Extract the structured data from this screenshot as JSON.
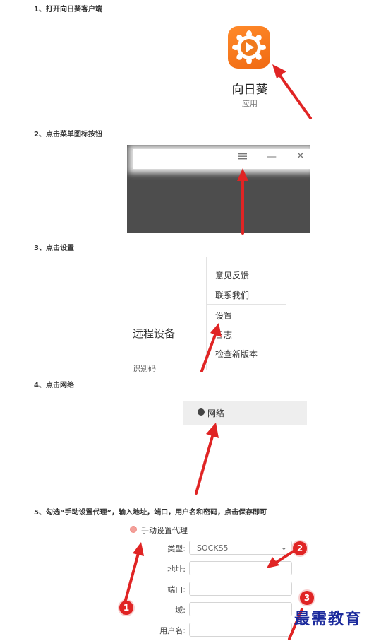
{
  "steps": {
    "step1": "1、打开向日葵客户端",
    "step2": "2、点击菜单图标按钮",
    "step3": "3、点击设置",
    "step4": "4、点击网络",
    "step5": "5、勾选“手动设置代理”，输入地址，端口，用户名和密码，点击保存即可"
  },
  "app": {
    "name": "向日葵",
    "subtitle": "应用"
  },
  "titlebar": {
    "menu_icon": "hamburger-icon",
    "minimize_glyph": "—",
    "close_glyph": "✕"
  },
  "menu": {
    "items": [
      "意见反馈",
      "联系我们",
      "设置",
      "日志",
      "检查新版本"
    ],
    "remote_label": "远程设备",
    "code_label": "识别码"
  },
  "network": {
    "label": "网络"
  },
  "proxy_form": {
    "radio_label": "手动设置代理",
    "type_label": "类型:",
    "type_value": "SOCKS5",
    "address_label": "地址:",
    "port_label": "端口:",
    "domain_label": "域:",
    "username_label": "用户名:"
  },
  "badges": {
    "one": "1",
    "two": "2",
    "three": "3"
  },
  "watermark": "最需教育",
  "colors": {
    "app_orange": "#f07a1c",
    "arrow_red": "#e02424",
    "watermark_blue": "#1b2a9c",
    "dark_panel": "#4d4d4d"
  }
}
